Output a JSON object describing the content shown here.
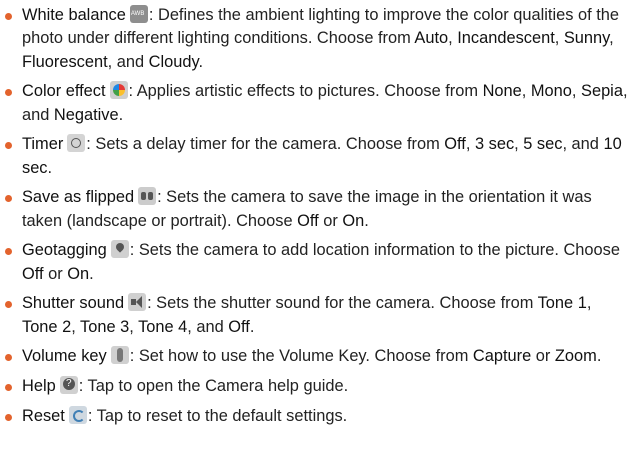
{
  "colors": {
    "bullet": "#e3632d",
    "text": "#222222"
  },
  "items": [
    {
      "term": "White balance",
      "icon": "white-balance-icon",
      "desc": ": Defines the ambient lighting to improve the color qualities of the photo under different lighting conditions. Choose from ",
      "options": [
        "Auto",
        "Incandescent",
        "Sunny",
        "Fluorescent",
        "Cloudy"
      ]
    },
    {
      "term": "Color effect",
      "icon": "color-effect-icon",
      "desc": ": Applies artistic effects to pictures. Choose from ",
      "options": [
        "None",
        "Mono",
        "Sepia",
        "Negative"
      ]
    },
    {
      "term": "Timer",
      "icon": "timer-icon",
      "desc": ": Sets a delay timer for the camera. Choose from ",
      "options": [
        "Off",
        "3 sec",
        "5 sec",
        "10 sec"
      ]
    },
    {
      "term": "Save as flipped",
      "icon": "flip-icon",
      "desc": ": Sets the camera to save the image in the orientation it was taken (landscape or portrait). Choose ",
      "options": [
        "Off",
        "On"
      ]
    },
    {
      "term": "Geotagging",
      "icon": "location-pin-icon",
      "desc": ": Sets the camera to add location information to the picture. Choose ",
      "options": [
        "Off",
        "On"
      ]
    },
    {
      "term": "Shutter sound",
      "icon": "shutter-sound-icon",
      "desc": ": Sets the shutter sound for the camera. Choose from ",
      "options": [
        "Tone 1",
        "Tone 2",
        "Tone 3",
        "Tone 4",
        "Off"
      ]
    },
    {
      "term": "Volume key",
      "icon": "volume-key-icon",
      "desc": ": Set how to use the Volume Key. Choose from ",
      "options": [
        "Capture",
        "Zoom"
      ]
    },
    {
      "term": "Help",
      "icon": "help-icon",
      "desc": ": Tap to open the Camera help guide.",
      "options": []
    },
    {
      "term": "Reset",
      "icon": "reset-icon",
      "desc": ": Tap to reset to the default settings.",
      "options": []
    }
  ],
  "words": {
    "comma": ", ",
    "and": ", and ",
    "or": " or ",
    "end": "."
  }
}
